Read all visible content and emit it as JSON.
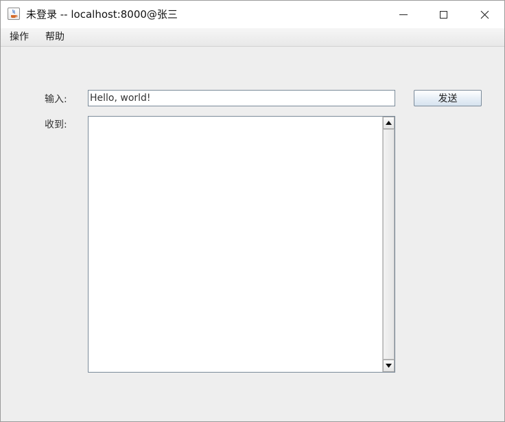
{
  "window": {
    "title": "未登录 -- localhost:8000@张三",
    "controls": {
      "minimize_icon": "minimize-icon",
      "maximize_icon": "maximize-icon",
      "close_icon": "close-icon"
    }
  },
  "menubar": {
    "items": [
      {
        "label": "操作"
      },
      {
        "label": "帮助"
      }
    ]
  },
  "form": {
    "input_label": "输入:",
    "input_value": "Hello, world!",
    "send_label": "发送",
    "received_label": "收到:",
    "received_text": ""
  },
  "icons": {
    "app": "java-coffee-icon",
    "scroll_up": "arrow-up-icon",
    "scroll_down": "arrow-down-icon"
  }
}
